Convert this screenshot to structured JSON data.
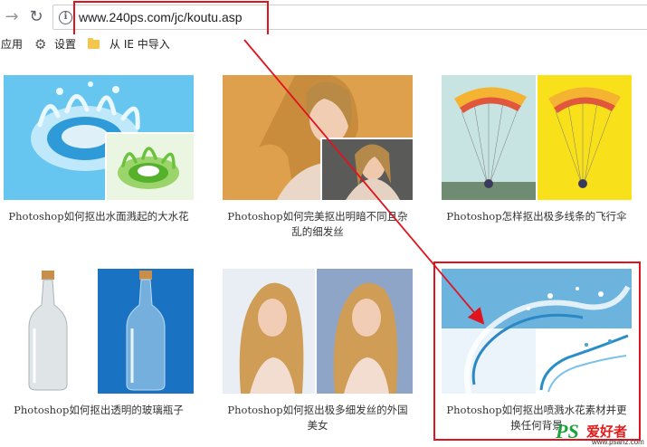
{
  "browser": {
    "url": "www.240ps.com/jc/koutu.asp",
    "info_glyph": "i",
    "back_glyph": "→",
    "reload_glyph": "↻"
  },
  "bookmarks": {
    "apps_label": "应用",
    "settings_label": "设置",
    "ie_import_label": "从 IE 中导入"
  },
  "articles": [
    {
      "title": "Photoshop如何抠出水面溅起的大水花",
      "image": "water-splash-crown"
    },
    {
      "title": "Photoshop如何完美抠出明暗不同且杂乱的细发丝",
      "image": "woman-portrait-hair"
    },
    {
      "title": "Photoshop怎样抠出极多线条的飞行伞",
      "image": "paraglider"
    },
    {
      "title": "Photoshop如何抠出透明的玻璃瓶子",
      "image": "glass-bottle"
    },
    {
      "title": "Photoshop如何抠出极多细发丝的外国美女",
      "image": "blonde-woman"
    },
    {
      "title": "Photoshop如何抠出喷溅水花素材并更换任何背景",
      "image": "water-splash-wave"
    }
  ],
  "watermark": {
    "logo": "PS",
    "name": "爱好者",
    "url": "www.psahz.com"
  },
  "colors": {
    "annotation_red": "#e0141e",
    "watermark_green": "#1aa33a"
  }
}
